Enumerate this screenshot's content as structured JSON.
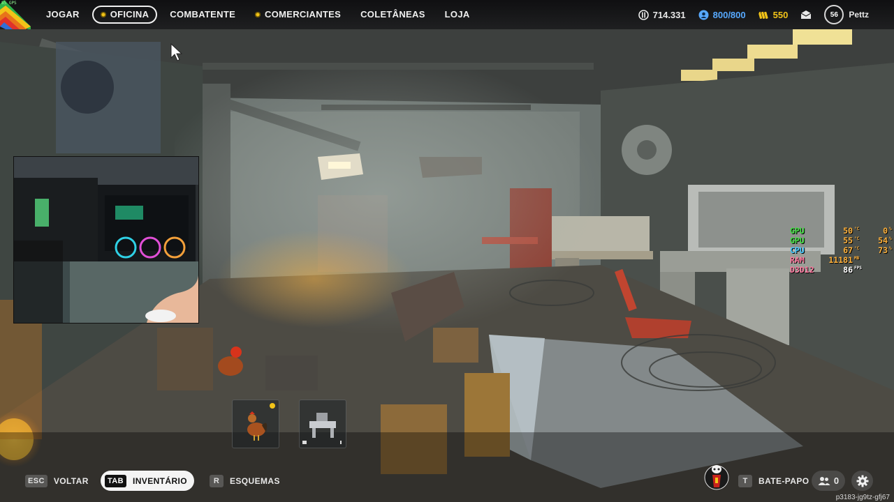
{
  "nav": {
    "items": [
      {
        "label": "JOGAR",
        "active": false,
        "dot": false
      },
      {
        "label": "OFICINA",
        "active": true,
        "dot": true
      },
      {
        "label": "COMBATENTE",
        "active": false,
        "dot": false
      },
      {
        "label": "COMERCIANTES",
        "active": false,
        "dot": true
      },
      {
        "label": "COLETÂNEAS",
        "active": false,
        "dot": false
      },
      {
        "label": "LOJA",
        "active": false,
        "dot": false
      }
    ]
  },
  "currencies": {
    "multibucks": "714.331",
    "workshop_tokens": "800/800",
    "coins": "550"
  },
  "player": {
    "level": "56",
    "name": "Pettz"
  },
  "overlay": {
    "fps_corner": "85 GPS",
    "rows": [
      {
        "label": "GPU",
        "value1": "50",
        "unit1": "°C",
        "value2": "0",
        "unit2": "%"
      },
      {
        "label": "GPU",
        "value1": "55",
        "unit1": "°C",
        "value2": "54",
        "unit2": "%"
      },
      {
        "label": "CPU",
        "value1": "67",
        "unit1": "°C",
        "value2": "73",
        "unit2": "%"
      },
      {
        "label": "RAM",
        "value1": "11181",
        "unit1": "MB",
        "value2": "",
        "unit2": ""
      },
      {
        "label": "D3D12",
        "value1": "86",
        "unit1": "FPS",
        "value2": "",
        "unit2": ""
      }
    ]
  },
  "bottom": {
    "back_key": "ESC",
    "back_label": "VOLTAR",
    "inventory_key": "TAB",
    "inventory_label": "INVENTÁRIO",
    "schemes_key": "R",
    "schemes_label": "ESQUEMAS",
    "chat_key": "T",
    "chat_label": "BATE-PAPO",
    "friends_count": "0"
  },
  "session_id": "p3183-jg9tz-gfj67",
  "colors": {
    "gold": "#f2c318",
    "blue": "#57a9ff",
    "overlay_green": "#3ee03e",
    "overlay_pink": "#ff7aa0",
    "overlay_orange": "#ffb13b"
  }
}
